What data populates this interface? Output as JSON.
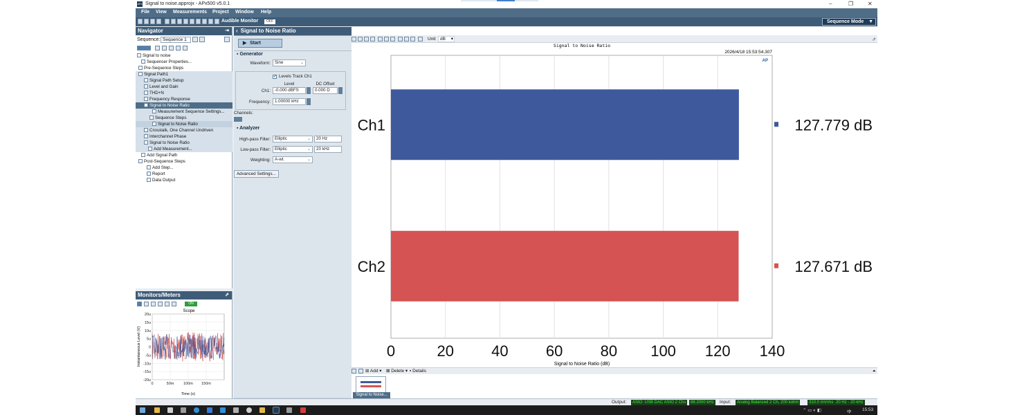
{
  "window": {
    "title": "Signal to noise.approjx - APx500 v5.0.1",
    "app_icon": "APx"
  },
  "menu": [
    "File",
    "View",
    "Measurements",
    "Project",
    "Window",
    "Help"
  ],
  "toolbar": {
    "audible_monitor": "Audible Monitor",
    "audible_state": "OFF",
    "mode": "Sequence Mode"
  },
  "navigator": {
    "title": "Navigator",
    "sequence_label": "Sequence:",
    "sequence_value": "Sequence 1",
    "tree": [
      "Signal to noise",
      "Sequencer Properties...",
      "Pre-Sequence Steps",
      "Signal Path1",
      "Signal Path Setup",
      "Level and Gain",
      "THD+N",
      "Frequency Response",
      "Signal to Noise Ratio",
      "Measurement Sequence Settings...",
      "Sequence Steps",
      "Signal to Noise Ratio",
      "Crosstalk, One Channel Undriven",
      "Interchannel Phase",
      "Signal to Noise Ratio",
      "Add Measurement...",
      "Add Signal Path",
      "Post-Sequence Steps",
      "Add Step...",
      "Report",
      "Data Output"
    ]
  },
  "monitors": {
    "title": "Monitors/Meters",
    "on_badge": "ON",
    "scope_title": "Scope",
    "ylabel": "Instantaneous Level (V)",
    "xlabel": "Time (s)",
    "yticks": [
      "20u",
      "15u",
      "10u",
      "5u",
      "0",
      "-5u",
      "-10u",
      "-15u",
      "-20u"
    ],
    "xticks": [
      "0",
      "50m",
      "100m",
      "150m"
    ]
  },
  "measurement": {
    "title": "Signal to Noise Ratio",
    "start": "Start",
    "generator": {
      "section": "Generator",
      "waveform_label": "Waveform:",
      "waveform": "Sine",
      "levels_track": "Levels Track Ch1",
      "level_col": "Level",
      "dc_col": "DC Offset",
      "ch1_label": "Ch1:",
      "ch1_level": "-0.000 dBFS",
      "ch1_dc": "0.000 D",
      "freq_label": "Frequency:",
      "frequency": "1.00000 kHz"
    },
    "channels_label": "Channels:",
    "analyzer": {
      "section": "Analyzer",
      "hp_label": "High-pass Filter:",
      "hp_type": "Elliptic",
      "hp_freq": "20 Hz",
      "lp_label": "Low-pass Filter:",
      "lp_type": "Elliptic",
      "lp_freq": "20 kHz",
      "weight_label": "Weighting:",
      "weighting": "A-wt."
    },
    "advanced": "Advanced Settings..."
  },
  "graph": {
    "unit_label": "Unit",
    "unit": "dB",
    "title": "Signal to Noise Ratio",
    "timestamp": "2026/4/18 15:53:54.307",
    "logo": "AP",
    "add": "Add",
    "delete": "Delete",
    "details": "Details",
    "thumb_label": "Signal to Noise..."
  },
  "chart_data": {
    "type": "bar",
    "orientation": "horizontal",
    "title": "Signal to Noise Ratio",
    "xlabel": "Signal to Noise Ratio (dB)",
    "xlim": [
      0,
      140
    ],
    "xticks": [
      0,
      20,
      40,
      60,
      80,
      100,
      120,
      140
    ],
    "categories": [
      "Ch1",
      "Ch2"
    ],
    "values": [
      127.779,
      127.671
    ],
    "value_labels": [
      "127.779 dB",
      "127.671 dB"
    ],
    "colors": [
      "#3f5a9c",
      "#d65353"
    ],
    "grid": true
  },
  "status": {
    "output_label": "Output:",
    "output_device": "ASIO: USB DAC ASIO 2 Chs",
    "output_rate": "88.2000 kHz",
    "input_label": "Input:",
    "input_device": "Analog Balanced 2 Ch, 200 kohm",
    "input_range": "310.0 mVrms",
    "input_bw": "20 Hz - 20 kHz"
  },
  "taskbar": {
    "ime": "中",
    "time": "15:53"
  }
}
